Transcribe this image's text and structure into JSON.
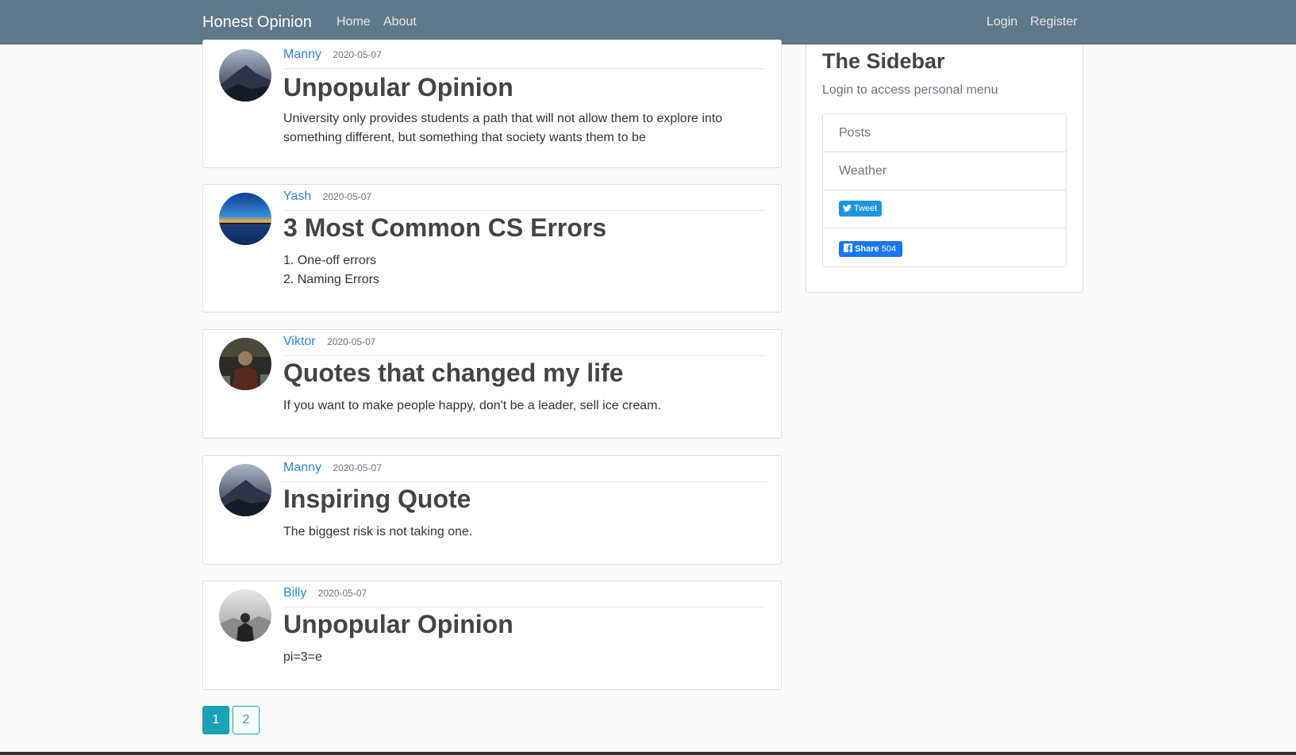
{
  "navbar": {
    "brand": "Honest Opinion",
    "links": [
      "Home",
      "About"
    ],
    "login": "Login",
    "register": "Register"
  },
  "posts": [
    {
      "author": "Manny",
      "date": "2020-05-07",
      "title": "Unpopular Opinion",
      "body_lines": [
        "University only provides students a path that will not allow them to explore into",
        "something different, but something that society wants them to be"
      ],
      "avatar": "dark-dunes"
    },
    {
      "author": "Yash",
      "date": "2020-05-07",
      "title": "3 Most Common CS Errors",
      "body_lines": [
        "1. One-off errors",
        "2. Naming Errors"
      ],
      "avatar": "sunset-sea"
    },
    {
      "author": "Viktor",
      "date": "2020-05-07",
      "title": "Quotes that changed my life",
      "body_lines": [
        "If you want to make people happy, don't be a leader, sell ice cream."
      ],
      "avatar": "person-photo"
    },
    {
      "author": "Manny",
      "date": "2020-05-07",
      "title": "Inspiring Quote",
      "body_lines": [
        "The biggest risk is not taking one."
      ],
      "avatar": "dark-dunes"
    },
    {
      "author": "Billy",
      "date": "2020-05-07",
      "title": "Unpopular Opinion",
      "body_lines": [
        "pi=3=e"
      ],
      "avatar": "misty-figure"
    }
  ],
  "sidebar": {
    "title": "The Sidebar",
    "subtitle": "Login to access personal menu",
    "items": [
      "Posts",
      "Weather"
    ],
    "tweet_label": "Tweet",
    "share_label": "Share",
    "share_count": "504"
  },
  "pagination": [
    "1",
    "2"
  ],
  "colors": {
    "navbar": "#5f788a",
    "link": "#2b86d6",
    "pagination": "#17a2b8",
    "twitter": "#1b95e0",
    "facebook": "#1877f2"
  }
}
